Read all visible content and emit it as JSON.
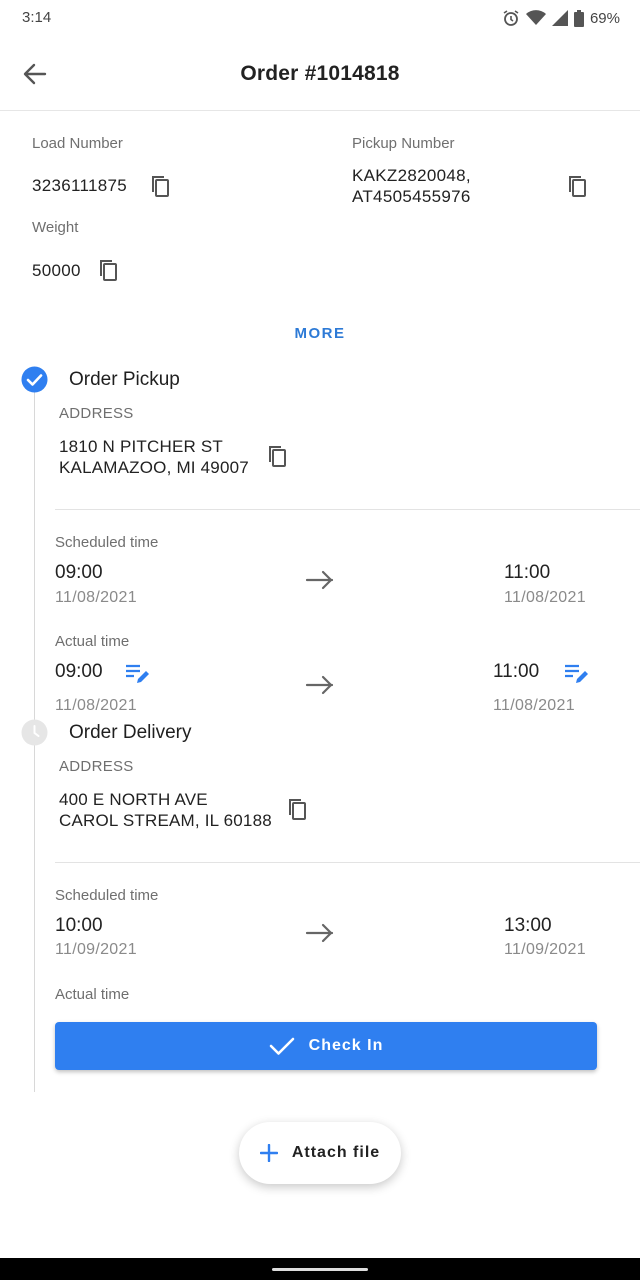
{
  "status_bar": {
    "time": "3:14",
    "battery": "69%"
  },
  "header": {
    "title": "Order #1014818",
    "back_icon": "arrow-left-icon"
  },
  "details": {
    "load_number_label": "Load Number",
    "load_number": "3236111875",
    "pickup_number_label": "Pickup Number",
    "pickup_number_line1": "KAKZ2820048,",
    "pickup_number_line2": "AT4505455976",
    "weight_label": "Weight",
    "weight": "50000",
    "more_label": "MORE"
  },
  "pickup": {
    "title": "Order Pickup",
    "status": "completed",
    "address_label": "ADDRESS",
    "address_line1": "1810 N PITCHER ST",
    "address_line2": "KALAMAZOO, MI 49007",
    "scheduled_label": "Scheduled time",
    "scheduled_start_time": "09:00",
    "scheduled_start_date": "11/08/2021",
    "scheduled_end_time": "11:00",
    "scheduled_end_date": "11/08/2021",
    "actual_label": "Actual time",
    "actual_start_time": "09:00",
    "actual_start_date": "11/08/2021",
    "actual_end_time": "11:00",
    "actual_end_date": "11/08/2021"
  },
  "delivery": {
    "title": "Order Delivery",
    "status": "pending",
    "address_label": "ADDRESS",
    "address_line1": "400 E NORTH AVE",
    "address_line2": "CAROL STREAM, IL 60188",
    "scheduled_label": "Scheduled time",
    "scheduled_start_time": "10:00",
    "scheduled_start_date": "11/09/2021",
    "scheduled_end_time": "13:00",
    "scheduled_end_date": "11/09/2021",
    "actual_label": "Actual time",
    "check_in_label": "Check In"
  },
  "fab": {
    "attach_label": "Attach file"
  },
  "colors": {
    "accent": "#2f7ff0",
    "link": "#2d7ad6",
    "pending": "#e6e6e6"
  }
}
